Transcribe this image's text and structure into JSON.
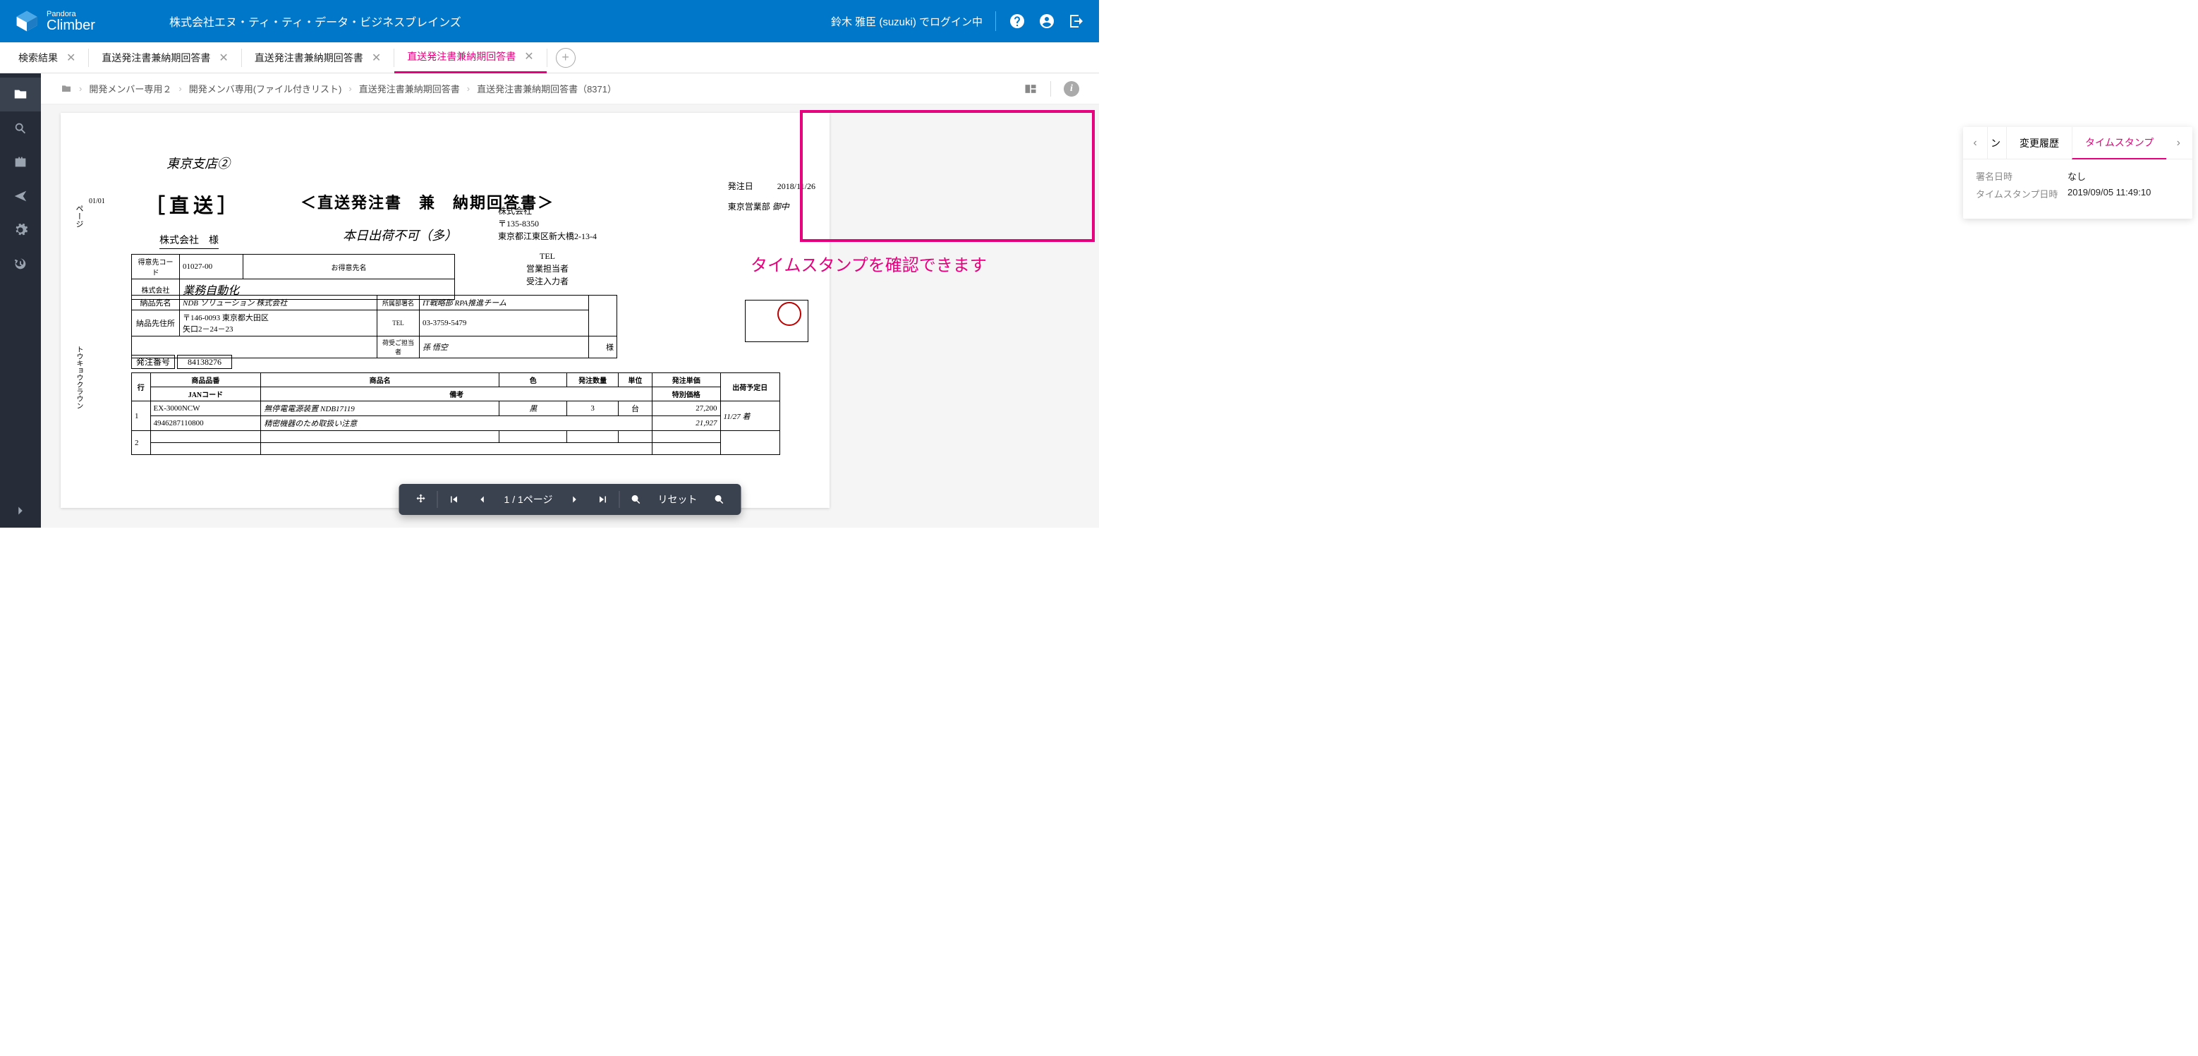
{
  "header": {
    "app_small": "Pandora",
    "app_large": "Climber",
    "company": "株式会社エヌ・ティ・ティ・データ・ビジネスブレインズ",
    "user_text": "鈴木 雅臣 (suzuki) でログイン中"
  },
  "tabs": [
    {
      "label": "検索結果",
      "closable": true,
      "active": false
    },
    {
      "label": "直送発注書兼納期回答書",
      "closable": true,
      "active": false
    },
    {
      "label": "直送発注書兼納期回答書",
      "closable": true,
      "active": false
    },
    {
      "label": "直送発注書兼納期回答書",
      "closable": true,
      "active": true
    }
  ],
  "breadcrumb": [
    "開発メンバー専用２",
    "開発メンバ専用(ファイル付きリスト)",
    "直送発注書兼納期回答書",
    "直送発注書兼納期回答書（8371）"
  ],
  "viewer_toolbar": {
    "page_text": "1 / 1ページ",
    "reset": "リセット"
  },
  "side_panel": {
    "tab_partial": "ン",
    "tab_history": "変更履歴",
    "tab_timestamp": "タイムスタンプ",
    "sign_label": "署名日時",
    "sign_value": "なし",
    "ts_label": "タイムスタンプ日時",
    "ts_value": "2019/09/05 11:49:10"
  },
  "annotation": "タイムスタンプを確認できます",
  "document": {
    "page_num": "01/01",
    "vert_label": "ページ",
    "side_vert": "トウキョウクラウン",
    "hand_branch": "東京支店②",
    "box_title": "［直送］",
    "main_title": "＜直送発注書　兼　納期回答書＞",
    "company_line": "株式会社　様",
    "hand_note": "本日出荷不可（多）",
    "right": {
      "order_date_label": "発注日",
      "order_date": "2018/11/26",
      "sales_office_label": "東京営業部",
      "sales_office_hand": "御中"
    },
    "middle": {
      "company": "株式会社",
      "postal": "〒135-8350",
      "address": "東京都江東区新大橋2-13-4",
      "tel_label": "TEL",
      "sales_person_label": "営業担当者",
      "input_person_label": "受注入力者"
    },
    "table1": {
      "code_label": "得意先コード",
      "code_value": "01027-00",
      "name_label": "お得意先名",
      "company_prefix": "株式会社",
      "company_hand": "業務自動化"
    },
    "table2": {
      "dest_label": "納品先名",
      "dest_hand": "NDB ソリューション 株式会社",
      "addr_label": "納品先住所",
      "addr1": "〒146-0093 東京都大田区",
      "addr2": "矢口2－24－23",
      "dept_label": "所属部署名",
      "dept_hand": "IT戦略部 RPA推進チーム",
      "tel_label": "TEL",
      "tel_value": "03-3759-5479",
      "recv_label": "荷受ご担当者",
      "recv_hand": "孫 悟空",
      "sama": "様"
    },
    "order": {
      "order_no_label": "発注番号",
      "order_no": "84138276",
      "col_row": "行",
      "col_item_no": "商品品番",
      "col_item_name": "商品名",
      "col_color": "色",
      "col_qty": "発注数量",
      "col_unit": "単位",
      "col_unit_price": "発注単価",
      "col_ship_date": "出荷予定日",
      "col_jan": "JANコード",
      "col_remarks": "備考",
      "col_special_price": "特別価格",
      "rows": [
        {
          "row": "1",
          "item_no": "EX-3000NCW",
          "jan": "4946287110800",
          "item_name": "無停電電源装置 NDB17119",
          "remarks": "精密機器のため取扱い注意",
          "color": "黒",
          "qty": "3",
          "unit": "台",
          "unit_price": "27,200",
          "special_price": "21,927",
          "ship_date": "11/27 着"
        },
        {
          "row": "2"
        }
      ]
    }
  }
}
